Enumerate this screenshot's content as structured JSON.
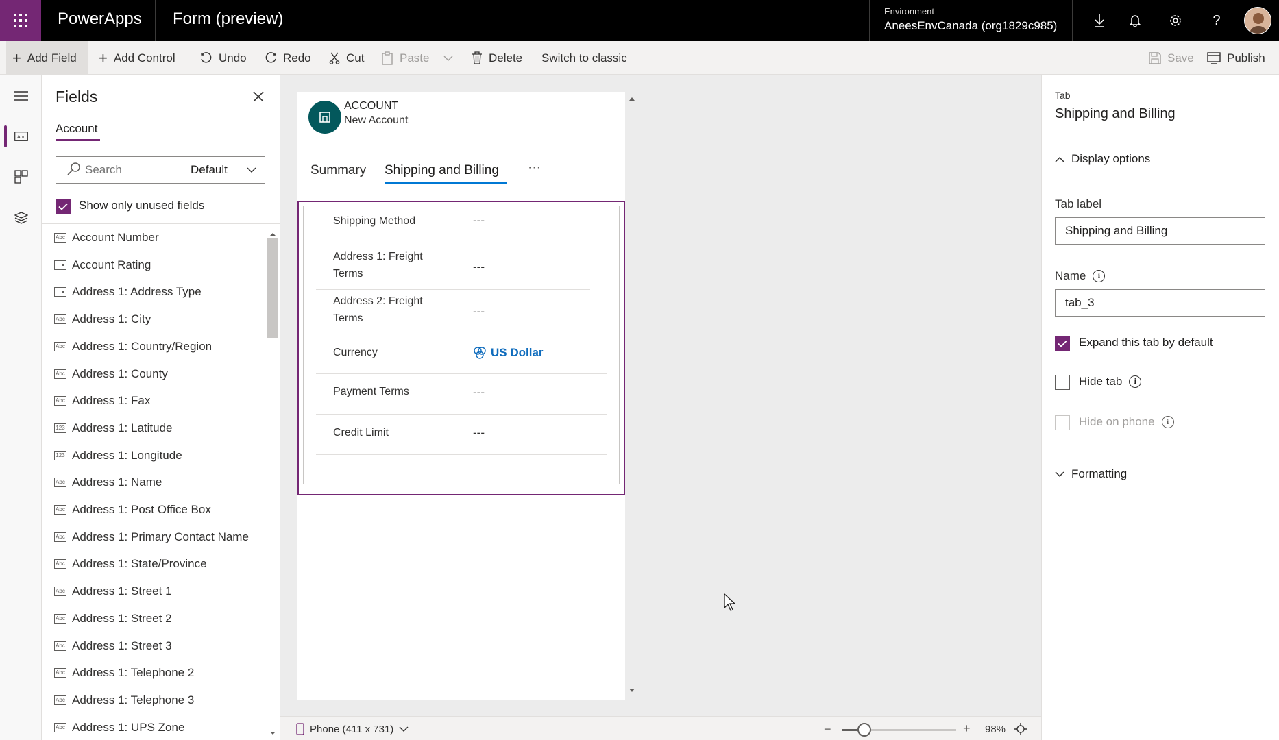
{
  "topbar": {
    "app_name": "PowerApps",
    "doc_title": "Form (preview)",
    "env_label": "Environment",
    "env_value": "AneesEnvCanada (org1829c985)"
  },
  "commands": {
    "add_field": "Add Field",
    "add_control": "Add Control",
    "undo": "Undo",
    "redo": "Redo",
    "cut": "Cut",
    "paste": "Paste",
    "delete": "Delete",
    "switch_classic": "Switch to classic",
    "save": "Save",
    "publish": "Publish"
  },
  "fields_panel": {
    "title": "Fields",
    "entity_tab": "Account",
    "search_placeholder": "Search",
    "filter_value": "Default",
    "unused_label": "Show only unused fields",
    "unused_checked": true,
    "items": [
      {
        "label": "Account Number",
        "icon": "Abc"
      },
      {
        "label": "Account Rating",
        "icon": "option"
      },
      {
        "label": "Address 1: Address Type",
        "icon": "option"
      },
      {
        "label": "Address 1: City",
        "icon": "Abc"
      },
      {
        "label": "Address 1: Country/Region",
        "icon": "Abc"
      },
      {
        "label": "Address 1: County",
        "icon": "Abc"
      },
      {
        "label": "Address 1: Fax",
        "icon": "Abc"
      },
      {
        "label": "Address 1: Latitude",
        "icon": "123"
      },
      {
        "label": "Address 1: Longitude",
        "icon": "123"
      },
      {
        "label": "Address 1: Name",
        "icon": "Abc"
      },
      {
        "label": "Address 1: Post Office Box",
        "icon": "Abc"
      },
      {
        "label": "Address 1: Primary Contact Name",
        "icon": "Abc"
      },
      {
        "label": "Address 1: State/Province",
        "icon": "Abc"
      },
      {
        "label": "Address 1: Street 1",
        "icon": "Abc"
      },
      {
        "label": "Address 1: Street 2",
        "icon": "Abc"
      },
      {
        "label": "Address 1: Street 3",
        "icon": "Abc"
      },
      {
        "label": "Address 1: Telephone 2",
        "icon": "Abc"
      },
      {
        "label": "Address 1: Telephone 3",
        "icon": "Abc"
      },
      {
        "label": "Address 1: UPS Zone",
        "icon": "Abc"
      }
    ]
  },
  "form": {
    "entity_type": "ACCOUNT",
    "record_name": "New Account",
    "tabs": [
      {
        "label": "Summary"
      },
      {
        "label": "Shipping and Billing"
      }
    ],
    "more": "···",
    "rows": [
      {
        "label_lines": [
          "Shipping Method"
        ],
        "value": "---"
      },
      {
        "label_lines": [
          "Address 1: Freight",
          "Terms"
        ],
        "value": "---"
      },
      {
        "label_lines": [
          "Address 2: Freight",
          "Terms"
        ],
        "value": "---"
      },
      {
        "label_lines": [
          "Currency"
        ],
        "value": "US Dollar"
      },
      {
        "label_lines": [
          "Payment Terms"
        ],
        "value": "---"
      },
      {
        "label_lines": [
          "Credit Limit"
        ],
        "value": "---"
      }
    ],
    "device": "Phone (411 x 731)",
    "zoom": "98%",
    "zoom_level": 0.2
  },
  "properties": {
    "kind": "Tab",
    "title": "Shipping and Billing",
    "display_options": "Display options",
    "tab_label_label": "Tab label",
    "tab_label_value": "Shipping and Billing",
    "name_label": "Name",
    "name_value": "tab_3",
    "expand_label": "Expand this tab by default",
    "expand_checked": true,
    "hide_tab_label": "Hide tab",
    "hide_phone_label": "Hide on phone",
    "formatting": "Formatting"
  },
  "colors": {
    "accent": "#742774",
    "link": "#0f6cbd",
    "tab_underline": "#0078d4"
  }
}
